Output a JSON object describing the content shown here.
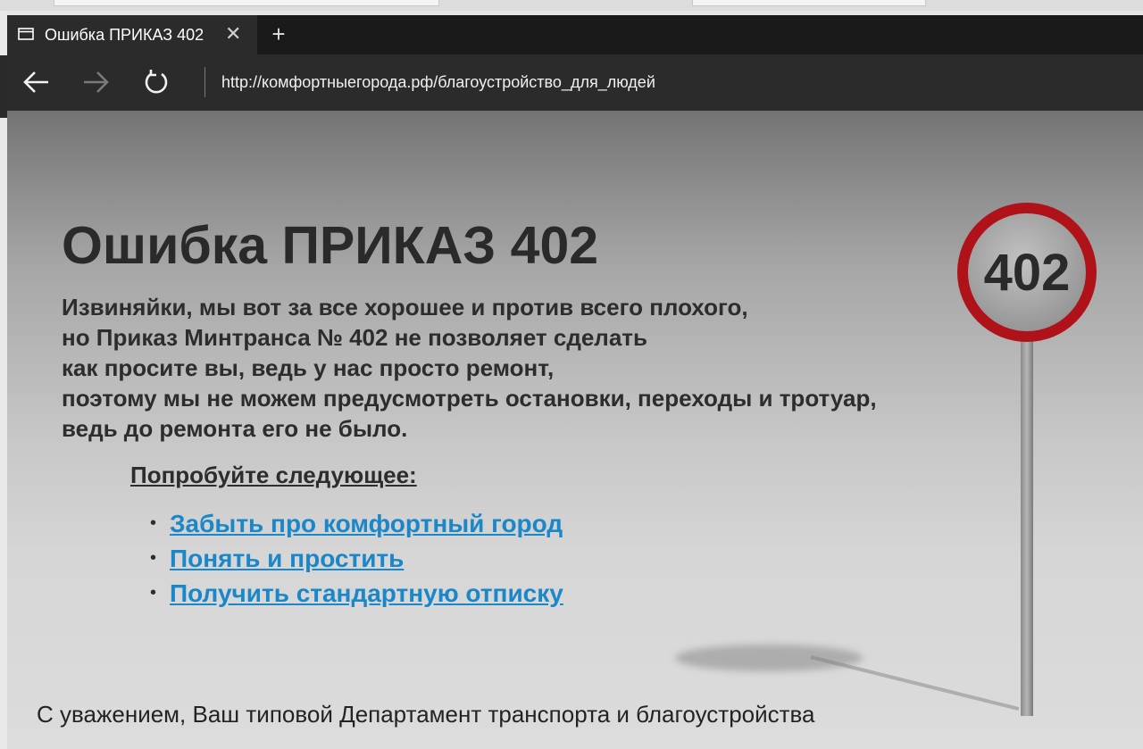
{
  "browser": {
    "tab": {
      "title": "Ошибка ПРИКАЗ 402",
      "close_icon": "close-icon",
      "page_icon": "page-icon"
    },
    "new_tab_icon": "plus-icon",
    "nav": {
      "back_icon": "back-arrow-icon",
      "forward_icon": "forward-arrow-icon",
      "refresh_icon": "refresh-icon"
    },
    "address_url": "http://комфортныегорода.рф/благоустройство_для_людей"
  },
  "page": {
    "heading": "Ошибка ПРИКАЗ 402",
    "message_lines": [
      "Извиняйки, мы вот за все хорошее и против всего плохого,",
      "но Приказ Минтранса № 402 не позволяет сделать",
      "как просите вы, ведь у нас просто ремонт,",
      "поэтому мы не можем предусмотреть остановки, переходы и тротуар,",
      "ведь до ремонта его не было."
    ],
    "try_heading": "Попробуйте следующее:",
    "links": [
      "Забыть про комфортный город",
      "Понять и простить",
      "Получить стандартную отписку"
    ],
    "bullet": "•",
    "sign_text": "402",
    "footer": "С уважением, Ваш типовой Департамент транспорта и благоустройства"
  },
  "colors": {
    "link": "#1a87c9",
    "sign_ring": "#b0121a",
    "chrome_bg": "#2b2b2b"
  }
}
